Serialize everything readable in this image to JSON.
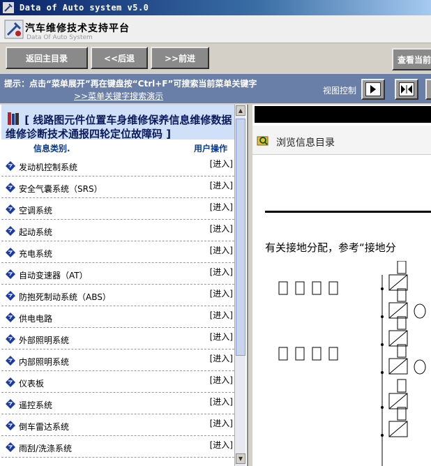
{
  "window": {
    "title": "Data of Auto system v5.0"
  },
  "header": {
    "title": "汽车维修技术支持平台",
    "subtitle": "Data Of Auto System"
  },
  "nav": {
    "back_label": "返回主目录",
    "prev_label": "<<后退",
    "next_label": ">>前进",
    "view_current_label": "查看当前"
  },
  "hint": {
    "text": "提示：点击“菜单展开”再在键盘按“Ctrl+F”可搜索当前菜单关键字",
    "demo_link": ">>菜单关键字搜索演示",
    "view_control_label": "视图控制"
  },
  "menu": {
    "heading": "[ 线路图元件位置车身维修保养信息维修数据维修诊断技术通报四轮定位故障码 ]",
    "col_category": "信息类别.",
    "col_action": "用户操作",
    "enter_label": "[进入]",
    "items": [
      "发动机控制系统",
      "安全气囊系统（SRS）",
      "空调系统",
      "起动系统",
      "充电系统",
      "自动变速器（AT）",
      "防抱死制动系统（ABS）",
      "供电电路",
      "外部照明系统",
      "内部照明系统",
      "仪表板",
      "遥控系统",
      "倒车雷达系统",
      "雨刮/洗涤系统"
    ]
  },
  "viewer": {
    "toolbar_label": "浏览信息目录",
    "doc_sentence": "有关接地分配，参考“接地分"
  },
  "icons": {
    "app": "wrench-icon",
    "logo": "logo-icon",
    "menu_item": "diamond-icon",
    "browse": "folder-search-icon"
  },
  "colors": {
    "title_bar": "#0a246a",
    "hint_bar": "#6a7fa8",
    "button": "#8a8a8a",
    "menu_head_bg": "#cfe0f8",
    "item_icon": "#1a3aa8"
  }
}
